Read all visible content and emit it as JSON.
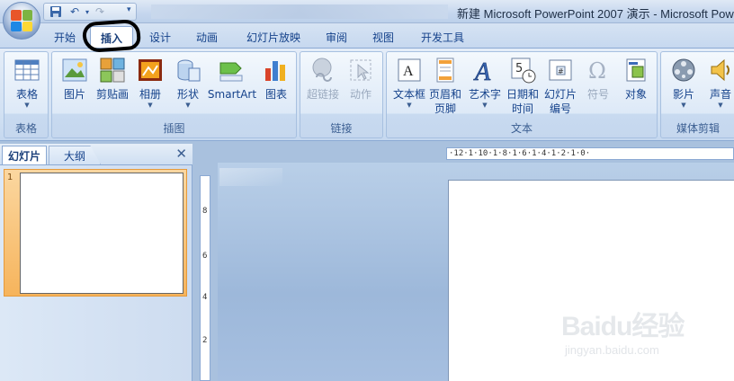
{
  "window": {
    "title": "新建 Microsoft PowerPoint 2007 演示 - Microsoft Pow"
  },
  "quick_access": {
    "save_icon": "save-icon",
    "undo_icon": "undo-icon",
    "redo_icon": "redo-icon",
    "customize_icon": "customize-dropdown-icon"
  },
  "tabs": [
    {
      "label": "开始"
    },
    {
      "label": "插入"
    },
    {
      "label": "设计"
    },
    {
      "label": "动画"
    },
    {
      "label": "幻灯片放映"
    },
    {
      "label": "审阅"
    },
    {
      "label": "视图"
    },
    {
      "label": "开发工具"
    }
  ],
  "active_tab": "插入",
  "ribbon": {
    "groups": [
      {
        "label": "表格"
      },
      {
        "label": "插图"
      },
      {
        "label": "链接"
      },
      {
        "label": "文本"
      },
      {
        "label": "媒体剪辑"
      }
    ],
    "buttons": {
      "table": {
        "line1": "表格",
        "icon": "table-icon"
      },
      "picture": {
        "line1": "图片",
        "icon": "picture-icon"
      },
      "clipart": {
        "line1": "剪贴画",
        "icon": "clipart-icon"
      },
      "album": {
        "line1": "相册",
        "icon": "photo-album-icon"
      },
      "shapes": {
        "line1": "形状",
        "icon": "shapes-icon"
      },
      "smartart": {
        "line1": "SmartArt",
        "icon": "smartart-icon"
      },
      "chart": {
        "line1": "图表",
        "icon": "chart-icon"
      },
      "hyperlink": {
        "line1": "超链接",
        "icon": "hyperlink-icon"
      },
      "action": {
        "line1": "动作",
        "icon": "action-icon"
      },
      "textbox": {
        "line1": "文本框",
        "icon": "textbox-icon"
      },
      "header_footer": {
        "line1": "页眉和",
        "line2": "页脚",
        "icon": "header-footer-icon"
      },
      "wordart": {
        "line1": "艺术字",
        "icon": "wordart-icon"
      },
      "datetime": {
        "line1": "日期和",
        "line2": "时间",
        "icon": "date-time-icon"
      },
      "slide_number": {
        "line1": "幻灯片",
        "line2": "编号",
        "icon": "slide-number-icon"
      },
      "symbol": {
        "line1": "符号",
        "icon": "symbol-icon"
      },
      "object": {
        "line1": "对象",
        "icon": "object-icon"
      },
      "movie": {
        "line1": "影片",
        "icon": "movie-icon"
      },
      "sound": {
        "line1": "声音",
        "icon": "sound-icon"
      }
    }
  },
  "slides_pane": {
    "tab_slides": "幻灯片",
    "tab_outline": "大纲",
    "close_glyph": "✕",
    "slide_numbers": [
      "1"
    ]
  },
  "rulers": {
    "horizontal_text": "·12·1·10·1·8·1·6·1·4·1·2·1·0·",
    "vertical_marks": [
      "8",
      "6",
      "4",
      "2"
    ]
  },
  "watermark": {
    "main": "Baidu经验",
    "sub": "jingyan.baidu.com"
  },
  "colors": {
    "ribbon_text": "#15428b",
    "workspace": "#a9c1de",
    "selected_slide": "#f6b45c"
  }
}
